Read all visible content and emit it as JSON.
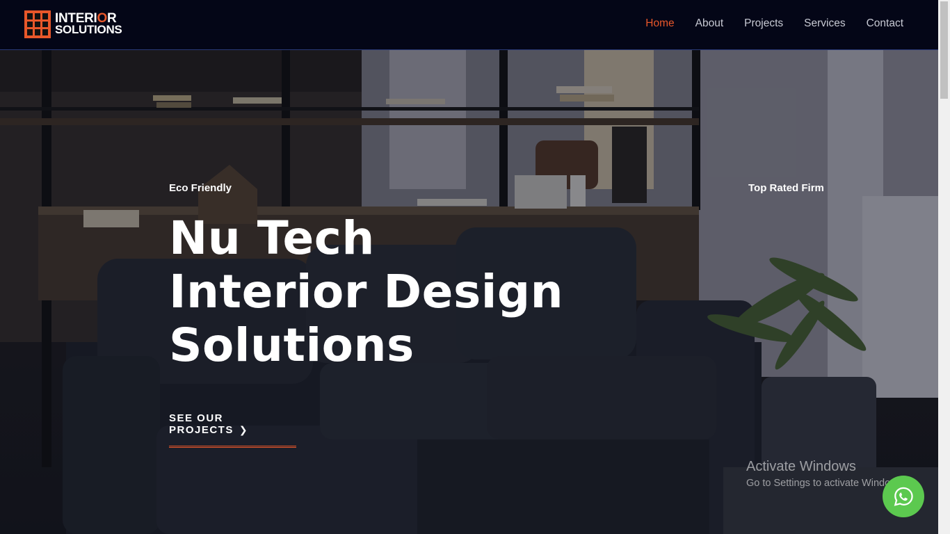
{
  "brand": {
    "line1_part1": "INTERI",
    "line1_accent": "O",
    "line1_part2": "R",
    "line2": "SOLUTIONS"
  },
  "nav": {
    "items": [
      {
        "label": "Home",
        "active": true
      },
      {
        "label": "About",
        "active": false
      },
      {
        "label": "Projects",
        "active": false
      },
      {
        "label": "Services",
        "active": false
      },
      {
        "label": "Contact",
        "active": false
      }
    ]
  },
  "hero": {
    "tag_left": "Eco Friendly",
    "tag_right": "Top Rated Firm",
    "headline": [
      "Nu Tech",
      "Interior Design",
      "Solutions"
    ],
    "cta_label": "SEE OUR PROJECTS",
    "cta_icon": "chevron-right-icon"
  },
  "watermark": {
    "title": "Activate Windows",
    "subtitle": "Go to Settings to activate Windows."
  },
  "floating": {
    "icon": "whatsapp-icon"
  },
  "colors": {
    "accent": "#e8572a",
    "header_bg": "#040617",
    "whatsapp": "#5cc94f"
  }
}
